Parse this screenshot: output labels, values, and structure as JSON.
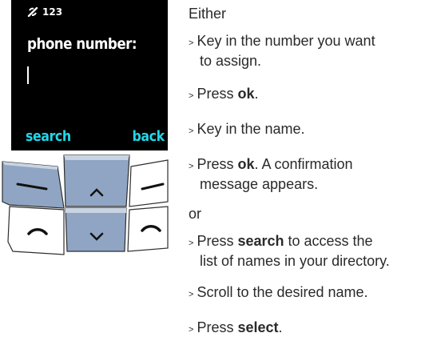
{
  "screen": {
    "status_number": "123",
    "prompt": "phone number:",
    "softkey_left": "search",
    "softkey_right": "back"
  },
  "icons": {
    "status": "phone-signal-icon",
    "left_soft": "left-softkey-icon",
    "up": "up-arrow-icon",
    "right_soft": "right-softkey-icon",
    "call": "call-icon",
    "down": "down-arrow-icon",
    "hangup": "hang-up-icon"
  },
  "colors": {
    "screen_bg": "#000000",
    "softkey_text": "#22d6e8",
    "key_blue": "#8fa5c3",
    "key_white": "#ffffff"
  },
  "instructions": {
    "either": "Either",
    "or": "or",
    "marker": ">",
    "steps1": [
      {
        "line1": "Key in the number you want",
        "line2": "to assign."
      },
      {
        "pre": "Press ",
        "bold": "ok",
        "post": "."
      },
      {
        "line1": "Key in the name."
      },
      {
        "pre": "Press ",
        "bold": "ok",
        "post": ". A confirmation",
        "line2": "message appears."
      }
    ],
    "steps2": [
      {
        "pre": "Press ",
        "bold": "search",
        "post": " to access the",
        "line2": "list of names in your directory."
      },
      {
        "line1": "Scroll to the desired name."
      },
      {
        "pre": "Press ",
        "bold": "select",
        "post": "."
      }
    ]
  }
}
